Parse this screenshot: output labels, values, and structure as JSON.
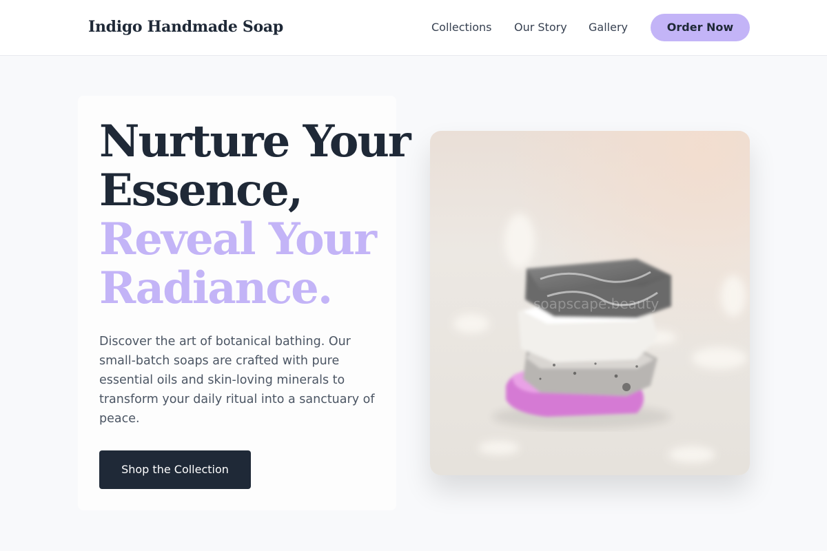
{
  "brand": {
    "name": "Indigo Handmade Soap"
  },
  "nav": {
    "items": [
      {
        "label": "Collections"
      },
      {
        "label": "Our Story"
      },
      {
        "label": "Gallery"
      }
    ],
    "cta": "Order Now"
  },
  "hero": {
    "headline_line1": "Nurture Your",
    "headline_line2": "Essence,",
    "accent_line1": "Reveal Your",
    "accent_line2": "Radiance.",
    "description": "Discover the art of botanical bathing. Our small-batch soaps are crafted with pure essential oils and skin-loving minerals to transform your daily ritual into a sanctuary of peace.",
    "cta": "Shop the Collection",
    "image_watermark": "soapscape.beauty"
  },
  "colors": {
    "accent": "#c3b4f7",
    "dark": "#1f2937",
    "text_muted": "#4b5563",
    "background": "#f8f9fb"
  }
}
